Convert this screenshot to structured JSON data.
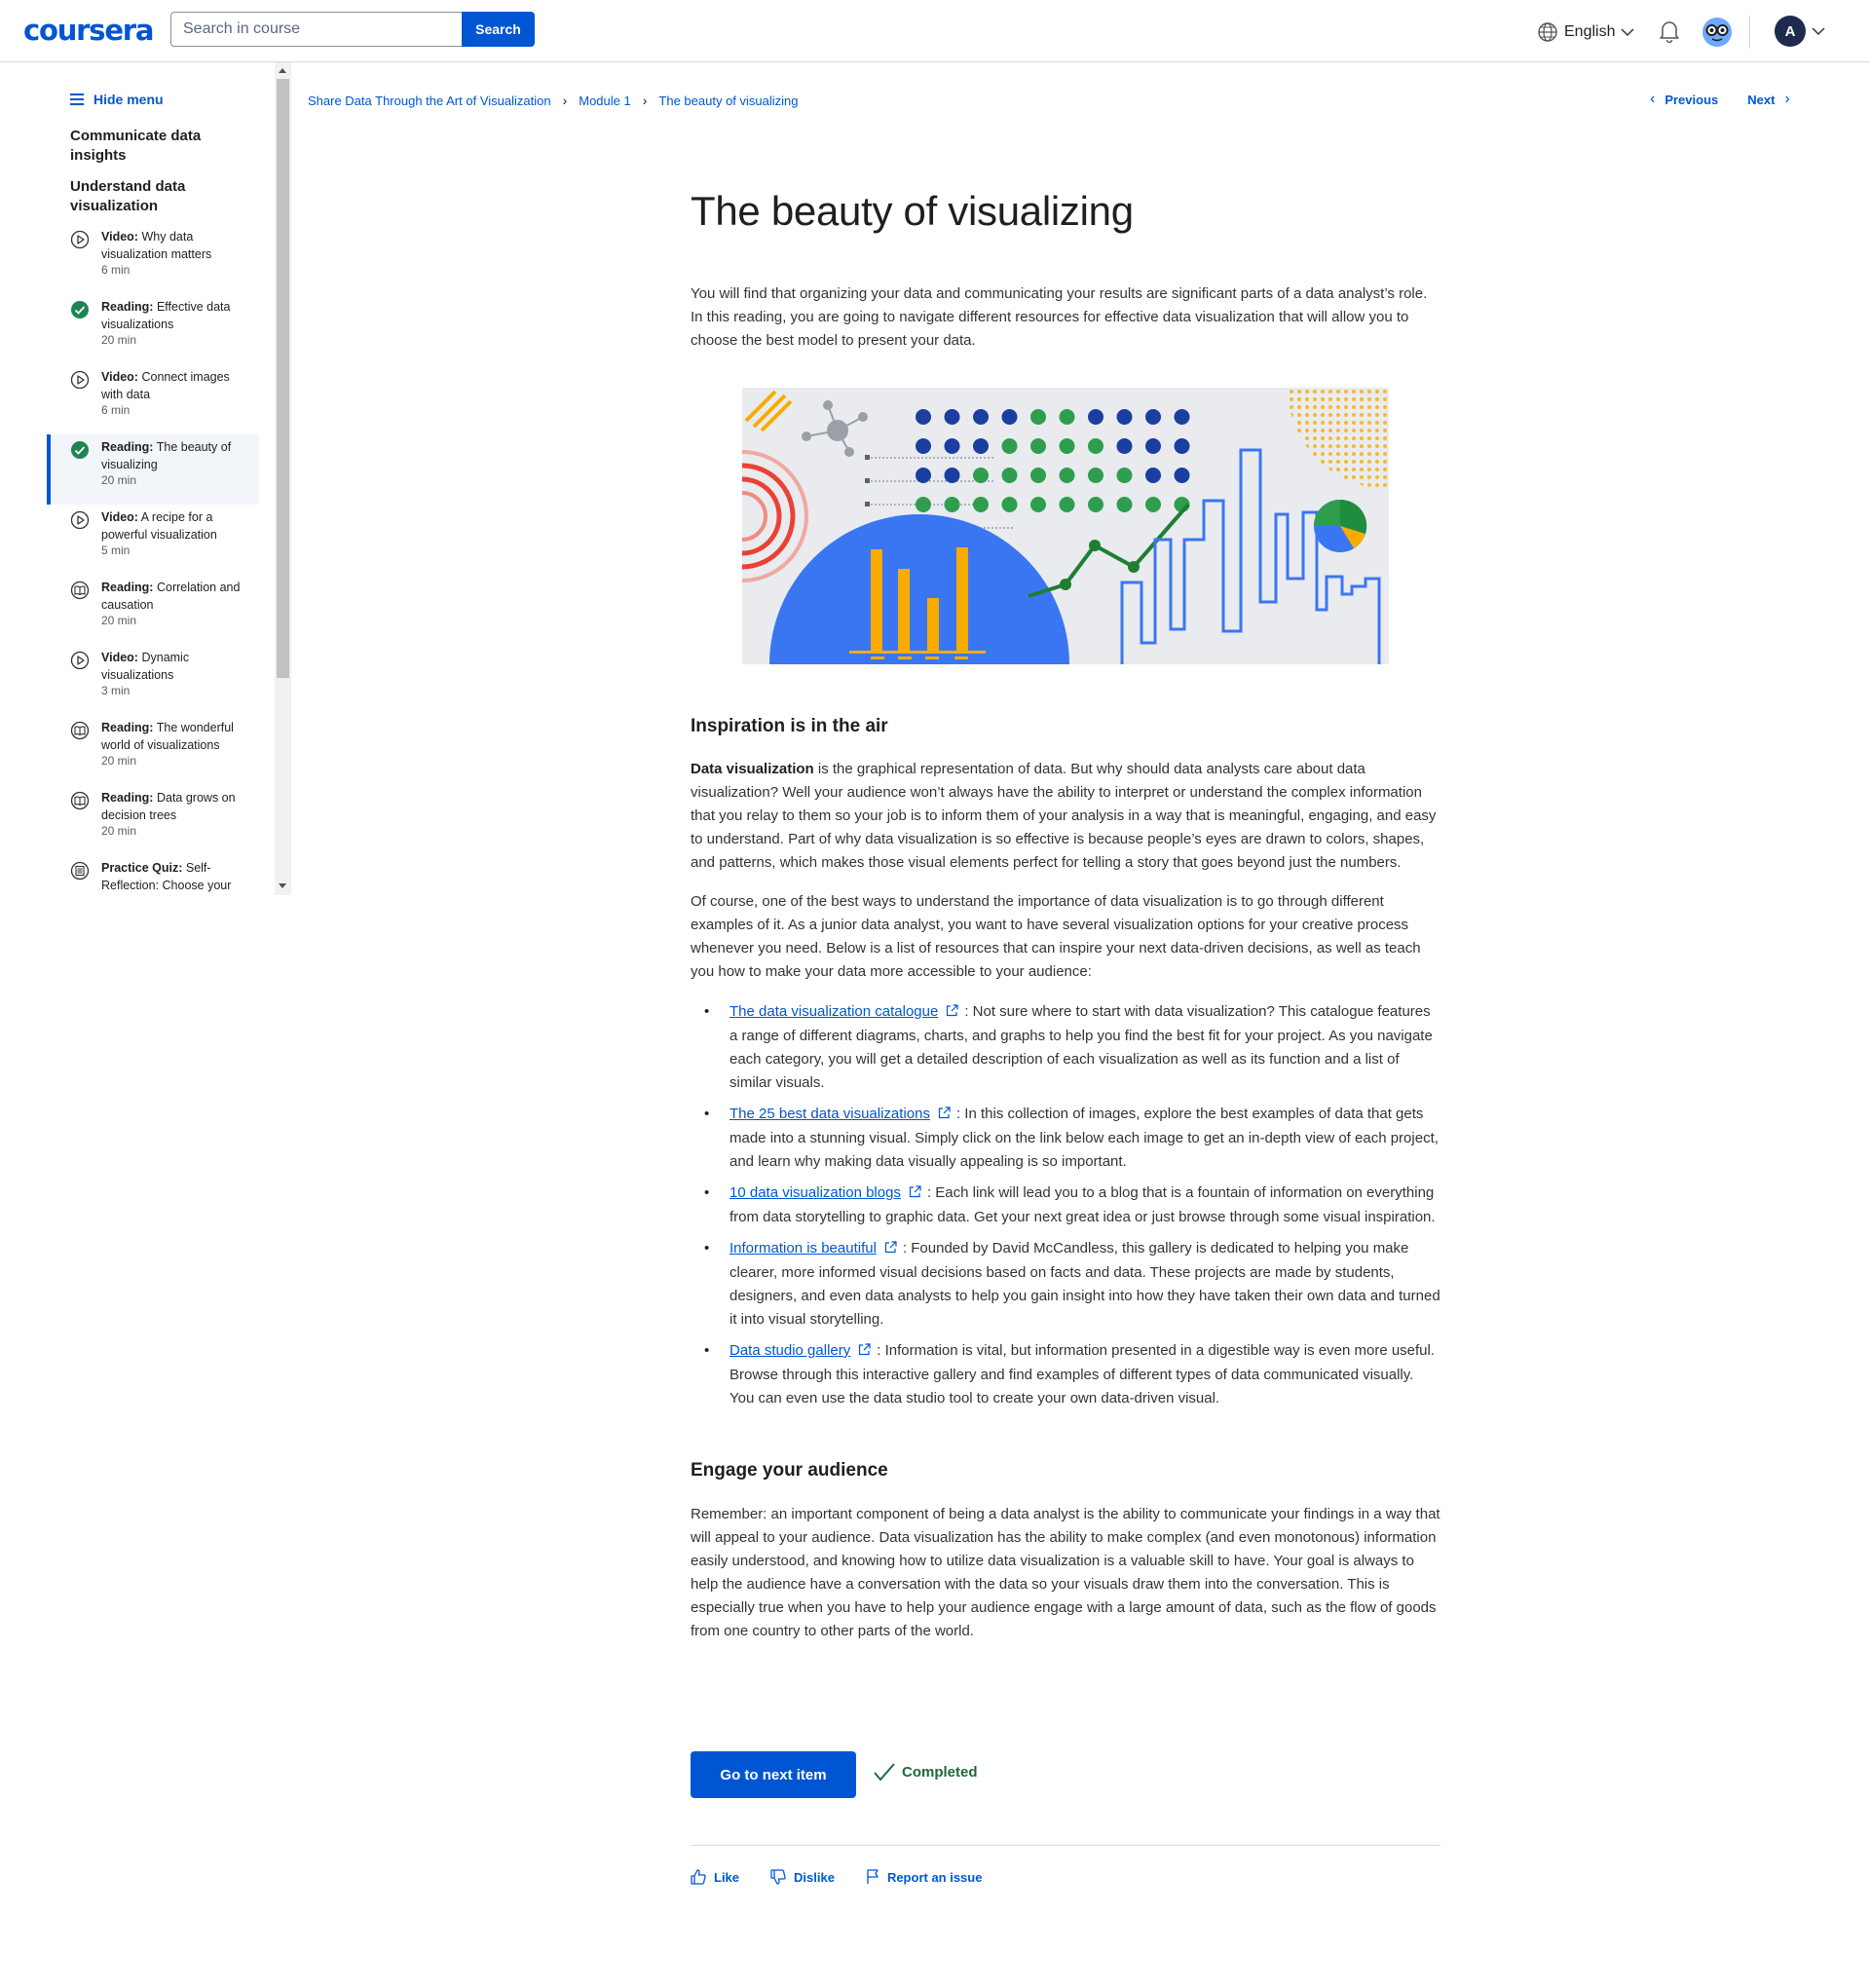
{
  "header": {
    "logo": "coursera",
    "search_placeholder": "Search in course",
    "search_button": "Search",
    "language": "English",
    "avatar_letter": "A"
  },
  "sidebar": {
    "hide_menu": "Hide menu",
    "module_titles": [
      "Communicate data insights",
      "Understand data visualization"
    ],
    "items": [
      {
        "type": "Video:",
        "title": "Why data visualization matters",
        "duration": "6 min",
        "icon": "play-icon"
      },
      {
        "type": "Reading:",
        "title": "Effective data visualizations",
        "duration": "20 min",
        "icon": "check-circle-icon"
      },
      {
        "type": "Video:",
        "title": "Connect images with data",
        "duration": "6 min",
        "icon": "play-icon"
      },
      {
        "type": "Reading:",
        "title": "The beauty of visualizing",
        "duration": "20 min",
        "icon": "check-circle-icon"
      },
      {
        "type": "Video:",
        "title": "A recipe for a powerful visualization",
        "duration": "5 min",
        "icon": "play-icon"
      },
      {
        "type": "Reading:",
        "title": "Correlation and causation",
        "duration": "20 min",
        "icon": "book-icon"
      },
      {
        "type": "Video:",
        "title": "Dynamic visualizations",
        "duration": "3 min",
        "icon": "play-icon"
      },
      {
        "type": "Reading:",
        "title": "The wonderful world of visualizations",
        "duration": "20 min",
        "icon": "book-icon"
      },
      {
        "type": "Reading:",
        "title": "Data grows on decision trees",
        "duration": "20 min",
        "icon": "book-icon"
      },
      {
        "type": "Practice Quiz:",
        "title": "Self-Reflection: Choose your",
        "duration": "",
        "icon": "quiz-icon"
      }
    ]
  },
  "breadcrumb": [
    "Share Data Through the Art of Visualization",
    "Module 1",
    "The beauty of visualizing"
  ],
  "nav": {
    "previous": "Previous",
    "next": "Next"
  },
  "content": {
    "title": "The beauty of visualizing",
    "intro": "You will find that organizing your data and communicating your results are significant parts of a data analyst’s role. In this reading, you are going to navigate different resources for effective data visualization that will allow you to choose the best model to present your data.",
    "section1_heading": "Inspiration is in the air",
    "para1_bold": "Data visualization",
    "para1_rest": " is the graphical representation of data. But why should data analysts care about data visualization? Well your audience won’t always have the ability to interpret or understand the complex information that you relay to them so your job is to inform them of your analysis in a way that is meaningful, engaging, and easy to understand. Part of why data visualization is so effective is because people’s eyes are drawn to colors, shapes, and patterns, which makes those visual elements perfect for telling a story that goes beyond just the numbers.",
    "para2": "Of course, one of the best ways to understand the importance of data visualization is to go through different examples of it. As a junior data analyst, you want to have several visualization options for your creative process whenever you need. Below is a list of resources that can inspire your next data-driven decisions, as well as teach you how to make your data more accessible to your audience:",
    "resources": [
      {
        "link": "The data visualization catalogue",
        "text": ": Not sure where to start with data visualization? This catalogue features a range of different diagrams, charts, and graphs to help you find the best fit for your project. As you navigate each category, you will get a detailed description of each visualization as well as its function and a list of similar visuals."
      },
      {
        "link": "The 25 best data visualizations",
        "text": ": In this collection of images, explore the best examples of data that gets made into a stunning visual. Simply click on the link below each image to get an in-depth view of each project, and learn why making data visually appealing is so important."
      },
      {
        "link": "10 data visualization blogs",
        "text": ": Each link will lead you to a blog that is a fountain of information on everything from data storytelling to graphic data. Get your next great idea or just browse through some visual inspiration."
      },
      {
        "link": "Information is beautiful",
        "text": ": Founded by David McCandless, this gallery is dedicated to helping you make clearer, more informed visual decisions based on facts and data. These projects are made by students, designers, and even data analysts to help you gain insight into how they have taken their own data and turned it into visual storytelling."
      },
      {
        "link": "Data studio gallery",
        "text": ": Information is vital, but information presented in a digestible way is even more useful. Browse through this interactive gallery and find examples of different types of data communicated visually. You can even use the data studio tool to create your own data-driven visual."
      }
    ],
    "section2_heading": "Engage your audience",
    "para3": "Remember: an important component of being a data analyst is the ability to communicate your findings in a way that will appeal to your audience. Data visualization has the ability to make complex (and even monotonous) information easily understood, and knowing how to utilize data visualization is a valuable skill to have. Your goal is always to help the audience have a conversation with the data so your visuals draw them into the conversation. This is especially true when you have to help your audience engage with a large amount of data, such as the flow of goods from one country to other parts of the world."
  },
  "footer": {
    "next_button": "Go to next item",
    "completed": "Completed",
    "like": "Like",
    "dislike": "Dislike",
    "report": "Report an issue"
  },
  "colors": {
    "accent": "#0056d2",
    "success": "#1f8354",
    "hero_bg": "#e9ebee",
    "hero_blue": "#3b76f2",
    "hero_orange": "#f9ab00",
    "hero_green": "#1e8e3e",
    "hero_red": "#e94235"
  }
}
